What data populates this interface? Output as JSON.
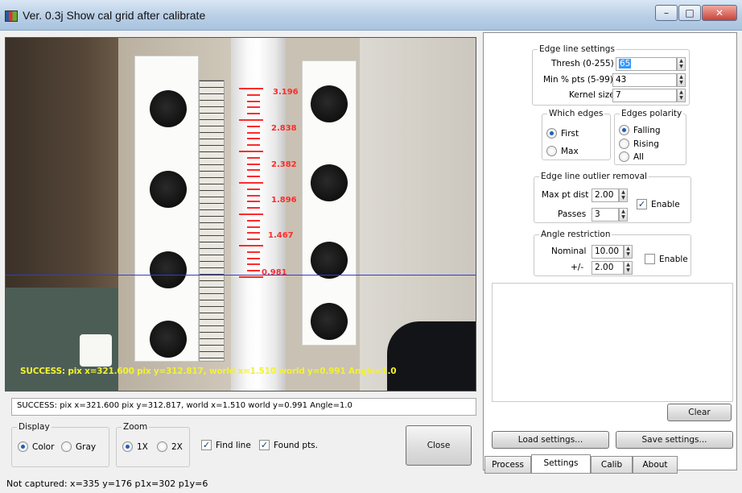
{
  "window": {
    "title": "Ver. 0.3j Show cal grid after calibrate"
  },
  "camera": {
    "overlay_text": "SUCCESS: pix x=321.600 pix y=312.817, world x=1.510 world y=0.991 Angle=1.0",
    "cal_labels": [
      "3.196",
      "2.838",
      "2.382",
      "1.896",
      "1.467",
      "0.981"
    ]
  },
  "status_box": {
    "text": "SUCCESS: pix x=321.600 pix y=312.817, world x=1.510 world y=0.991 Angle=1.0"
  },
  "display_group": {
    "legend": "Display",
    "options": [
      "Color",
      "Gray"
    ],
    "selected": "Color"
  },
  "zoom_group": {
    "legend": "Zoom",
    "options": [
      "1X",
      "2X"
    ],
    "selected": "1X"
  },
  "checks": {
    "find_line": "Find line",
    "found_pts": "Found pts."
  },
  "close_button": "Close",
  "edge_line_settings": {
    "legend": "Edge line settings",
    "thresh_label": "Thresh (0-255)",
    "thresh_value": "65",
    "min_pts_label": "Min % pts (5-99)",
    "min_pts_value": "43",
    "kernel_label": "Kernel size",
    "kernel_value": "7"
  },
  "which_edges": {
    "legend": "Which edges",
    "options": [
      "First",
      "Max"
    ],
    "selected": "First"
  },
  "edges_polarity": {
    "legend": "Edges polarity",
    "options": [
      "Falling",
      "Rising",
      "All"
    ],
    "selected": "Falling"
  },
  "outlier_removal": {
    "legend": "Edge line outlier removal",
    "max_pt_dist_label": "Max pt dist",
    "max_pt_dist_value": "2.00",
    "passes_label": "Passes",
    "passes_value": "3",
    "enable_label": "Enable"
  },
  "angle_restriction": {
    "legend": "Angle restriction",
    "nominal_label": "Nominal",
    "nominal_value": "10.00",
    "plusminus_label": "+/-",
    "plusminus_value": "2.00",
    "enable_label": "Enable"
  },
  "buttons": {
    "clear": "Clear",
    "load_settings": "Load settings...",
    "save_settings": "Save settings..."
  },
  "tabs": [
    "Process",
    "Settings",
    "Calib",
    "About"
  ],
  "active_tab": "Settings",
  "status_line": "Not captured:  x=335 y=176 p1x=302 p1y=6"
}
